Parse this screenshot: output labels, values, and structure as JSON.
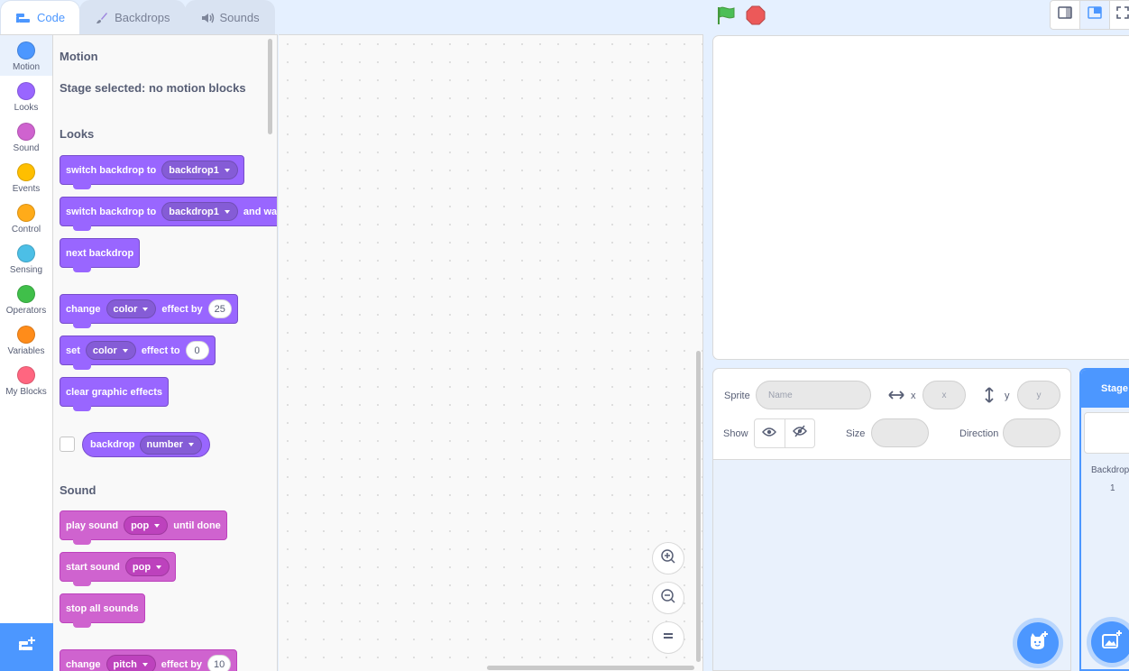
{
  "tabs": [
    {
      "label": "Code",
      "icon": "code-icon",
      "active": true
    },
    {
      "label": "Backdrops",
      "icon": "paintbrush-icon",
      "active": false
    },
    {
      "label": "Sounds",
      "icon": "speaker-icon",
      "active": false
    }
  ],
  "categories": [
    {
      "label": "Motion",
      "color": "#4c97ff"
    },
    {
      "label": "Looks",
      "color": "#9966ff"
    },
    {
      "label": "Sound",
      "color": "#cf63cf"
    },
    {
      "label": "Events",
      "color": "#ffbf00"
    },
    {
      "label": "Control",
      "color": "#ffab19"
    },
    {
      "label": "Sensing",
      "color": "#4cbfe6"
    },
    {
      "label": "Operators",
      "color": "#40bf4a"
    },
    {
      "label": "Variables",
      "color": "#ff8c1a"
    },
    {
      "label": "My Blocks",
      "color": "#ff6680"
    }
  ],
  "palette": {
    "motion_heading": "Motion",
    "motion_note": "Stage selected: no motion blocks",
    "looks_heading": "Looks",
    "sound_heading": "Sound",
    "looks_blocks": {
      "switch_backdrop": {
        "text": "switch backdrop to",
        "dropdown": "backdrop1"
      },
      "switch_backdrop_wait": {
        "text": "switch backdrop to",
        "dropdown": "backdrop1",
        "suffix": "and wait"
      },
      "next_backdrop": {
        "text": "next backdrop"
      },
      "change_effect": {
        "text": "change",
        "dropdown": "color",
        "middle": "effect by",
        "value": "25"
      },
      "set_effect": {
        "text": "set",
        "dropdown": "color",
        "middle": "effect to",
        "value": "0"
      },
      "clear_effects": {
        "text": "clear graphic effects"
      },
      "backdrop_reporter": {
        "text": "backdrop",
        "dropdown": "number"
      }
    },
    "sound_blocks": {
      "play_sound": {
        "text": "play sound",
        "dropdown": "pop",
        "suffix": "until done"
      },
      "start_sound": {
        "text": "start sound",
        "dropdown": "pop"
      },
      "stop_all": {
        "text": "stop all sounds"
      },
      "change_pitch": {
        "text": "change",
        "dropdown": "pitch",
        "middle": "effect by",
        "value": "10"
      }
    }
  },
  "sprite_info": {
    "sprite_label": "Sprite",
    "name_placeholder": "Name",
    "x_label": "x",
    "x_placeholder": "x",
    "y_label": "y",
    "y_placeholder": "y",
    "show_label": "Show",
    "size_label": "Size",
    "direction_label": "Direction"
  },
  "stage_pane": {
    "header": "Stage",
    "backdrops_label": "Backdrops",
    "backdrops_count": "1"
  },
  "colors": {
    "accent": "#4c97ff",
    "looks": "#9966ff",
    "sound": "#cf63cf",
    "flag": "#4cbf56",
    "stop": "#ec5959"
  }
}
